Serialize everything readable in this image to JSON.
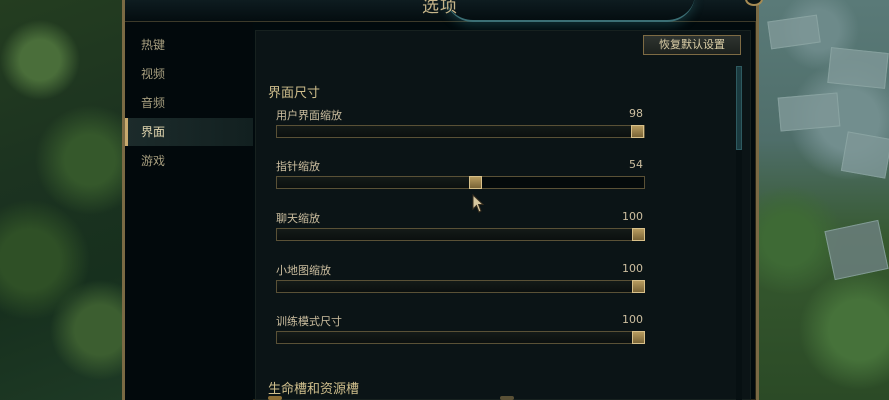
{
  "window": {
    "title": "选项"
  },
  "sidebar": {
    "items": [
      {
        "label": "热键",
        "active": false
      },
      {
        "label": "视频",
        "active": false
      },
      {
        "label": "音频",
        "active": false
      },
      {
        "label": "界面",
        "active": true
      },
      {
        "label": "游戏",
        "active": false
      }
    ]
  },
  "toolbar": {
    "reset_label": "恢复默认设置"
  },
  "sections": {
    "interface_size": {
      "title": "界面尺寸",
      "sliders": [
        {
          "label": "用户界面缩放",
          "value": "98",
          "fraction": 0.98
        },
        {
          "label": "指针缩放",
          "value": "54",
          "fraction": 0.54
        },
        {
          "label": "聊天缩放",
          "value": "100",
          "fraction": 1.0
        },
        {
          "label": "小地图缩放",
          "value": "100",
          "fraction": 1.0
        },
        {
          "label": "训练模式尺寸",
          "value": "100",
          "fraction": 1.0
        }
      ]
    },
    "health_resource": {
      "title": "生命槽和资源槽"
    }
  },
  "colors": {
    "accent_gold": "#c8aa6e",
    "panel_bg": "#010a0d",
    "teal_glow": "#3b6f75"
  },
  "icons": {
    "cursor": "mouse-pointer-icon"
  }
}
